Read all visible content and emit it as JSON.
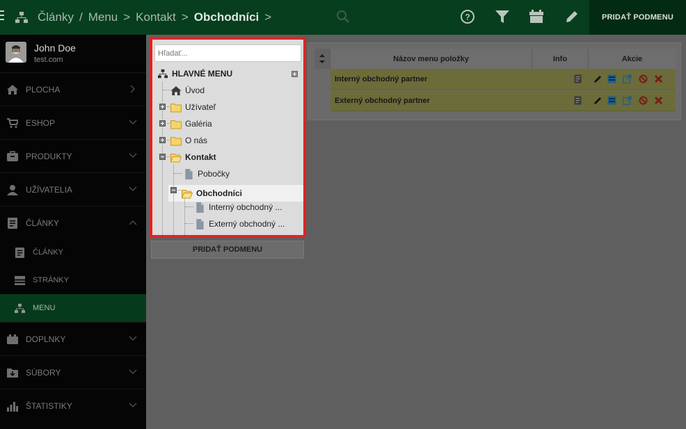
{
  "topbar": {
    "breadcrumb": [
      {
        "label": "Články"
      },
      {
        "label": "Menu"
      },
      {
        "label": "Kontakt"
      },
      {
        "label": "Obchodníci"
      }
    ],
    "sep_slash": "/",
    "sep_arrow": ">",
    "button_label": "PRIDAŤ PODMENU",
    "icons": [
      "hamburger-icon",
      "sitemap-icon",
      "search-icon",
      "help-icon",
      "filter-icon",
      "archive-icon",
      "pencil-icon"
    ]
  },
  "sidebar": {
    "user_name": "John Doe",
    "user_email": "test.com",
    "items": [
      {
        "label": "PLOCHA",
        "icon": "home-icon"
      },
      {
        "label": "ESHOP",
        "icon": "cart-icon"
      },
      {
        "label": "PRODUKTY",
        "icon": "box-icon"
      },
      {
        "label": "UŽÍVATELIA",
        "icon": "user-icon"
      },
      {
        "label": "ČLÁNKY",
        "icon": "article-icon"
      },
      {
        "label": "DOPLNKY",
        "icon": "plugin-icon"
      },
      {
        "label": "SÚBORY",
        "icon": "file-icon"
      },
      {
        "label": "ŠTATISTIKY",
        "icon": "stats-icon"
      }
    ],
    "sub_items": [
      {
        "label": "ČLÁNKY",
        "icon": "article-icon"
      },
      {
        "label": "STRÁNKY",
        "icon": "page-icon"
      },
      {
        "label": "MENU",
        "icon": "sitemap-icon"
      }
    ]
  },
  "tree": {
    "search_placeholder": "Hľadať...",
    "root": "HLAVNÉ MENU",
    "nodes": [
      {
        "label": "Úvod",
        "icon": "home-icon"
      },
      {
        "label": "Užívateľ",
        "icon": "folder-icon"
      },
      {
        "label": "Galéria",
        "icon": "folder-icon"
      },
      {
        "label": "O nás",
        "icon": "folder-icon"
      },
      {
        "label": "Kontakt",
        "icon": "folder-open-icon"
      },
      {
        "label": "Pobočky",
        "icon": "page-icon"
      },
      {
        "label": "Obchodníci",
        "icon": "folder-open-icon"
      },
      {
        "label": "Interný obchodný ...",
        "icon": "page-icon"
      },
      {
        "label": "Externý obchodný ...",
        "icon": "page-icon"
      }
    ],
    "add_button": "PRIDAŤ PODMENU"
  },
  "table": {
    "headers": [
      "Názov menu položky",
      "Info",
      "Akcie"
    ],
    "rows": [
      {
        "name": "Interný obchodný partner"
      },
      {
        "name": "Externý obchodný partner"
      }
    ]
  },
  "colors": {
    "topbar": "#063e1e",
    "active_nav": "#063a1c",
    "highlight_border": "#e52222",
    "row_bg": "#6b6c3a"
  }
}
